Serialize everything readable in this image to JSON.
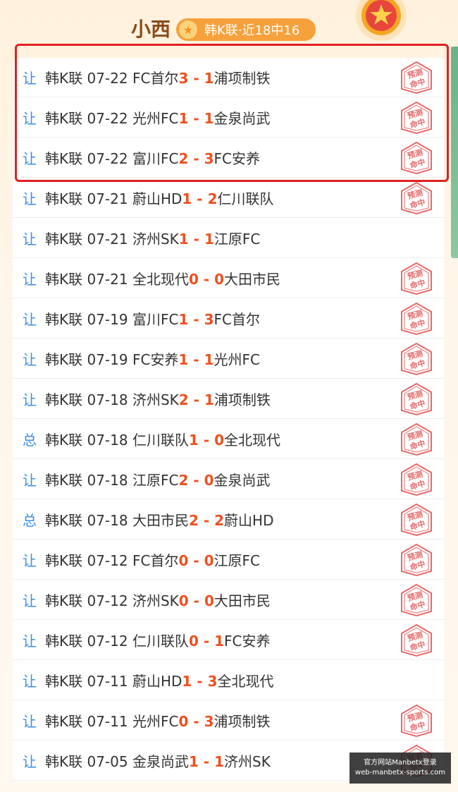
{
  "header": {
    "tipster_name": "小西",
    "badge_text": "韩K联·近18中16"
  },
  "matches": [
    {
      "type": "让",
      "league": "韩K联",
      "date": "07-22",
      "home": "FC首尔",
      "home_score": "3",
      "sep": " - ",
      "away_score": "1",
      "away": "浦项制铁",
      "hit": true
    },
    {
      "type": "让",
      "league": "韩K联",
      "date": "07-22",
      "home": "光州FC",
      "home_score": "1",
      "sep": " - ",
      "away_score": "1",
      "away": "金泉尚武",
      "hit": true
    },
    {
      "type": "让",
      "league": "韩K联",
      "date": "07-22",
      "home": "富川FC",
      "home_score": "2",
      "sep": " - ",
      "away_score": "3",
      "away": "FC安养",
      "hit": true
    },
    {
      "type": "让",
      "league": "韩K联",
      "date": "07-21",
      "home": "蔚山HD",
      "home_score": "1",
      "sep": " - ",
      "away_score": "2",
      "away": "仁川联队",
      "hit": true
    },
    {
      "type": "让",
      "league": "韩K联",
      "date": "07-21",
      "home": "济州SK",
      "home_score": "1",
      "sep": " - ",
      "away_score": "1",
      "away": "江原FC",
      "hit": false
    },
    {
      "type": "让",
      "league": "韩K联",
      "date": "07-21",
      "home": "全北现代",
      "home_score": "0",
      "sep": " - ",
      "away_score": "0",
      "away": "大田市民",
      "hit": true
    },
    {
      "type": "让",
      "league": "韩K联",
      "date": "07-19",
      "home": "富川FC",
      "home_score": "1",
      "sep": " - ",
      "away_score": "3",
      "away": "FC首尔",
      "hit": true
    },
    {
      "type": "让",
      "league": "韩K联",
      "date": "07-19",
      "home": "FC安养",
      "home_score": "1",
      "sep": " - ",
      "away_score": "1",
      "away": "光州FC",
      "hit": true
    },
    {
      "type": "让",
      "league": "韩K联",
      "date": "07-18",
      "home": "济州SK",
      "home_score": "2",
      "sep": " - ",
      "away_score": "1",
      "away": "浦项制铁",
      "hit": true
    },
    {
      "type": "总",
      "league": "韩K联",
      "date": "07-18",
      "home": "仁川联队",
      "home_score": "1",
      "sep": " - ",
      "away_score": "0",
      "away": "全北现代",
      "hit": true
    },
    {
      "type": "让",
      "league": "韩K联",
      "date": "07-18",
      "home": "江原FC",
      "home_score": "2",
      "sep": " - ",
      "away_score": "0",
      "away": "金泉尚武",
      "hit": true
    },
    {
      "type": "总",
      "league": "韩K联",
      "date": "07-18",
      "home": "大田市民",
      "home_score": "2",
      "sep": " - ",
      "away_score": "2",
      "away": "蔚山HD",
      "hit": true
    },
    {
      "type": "让",
      "league": "韩K联",
      "date": "07-12",
      "home": "FC首尔",
      "home_score": "0",
      "sep": " - ",
      "away_score": "0",
      "away": "江原FC",
      "hit": true
    },
    {
      "type": "让",
      "league": "韩K联",
      "date": "07-12",
      "home": "济州SK",
      "home_score": "0",
      "sep": " - ",
      "away_score": "0",
      "away": "大田市民",
      "hit": true
    },
    {
      "type": "让",
      "league": "韩K联",
      "date": "07-12",
      "home": "仁川联队",
      "home_score": "0",
      "sep": " - ",
      "away_score": "1",
      "away": "FC安养",
      "hit": true
    },
    {
      "type": "让",
      "league": "韩K联",
      "date": "07-11",
      "home": "蔚山HD",
      "home_score": "1",
      "sep": " - ",
      "away_score": "3",
      "away": "全北现代",
      "hit": false
    },
    {
      "type": "让",
      "league": "韩K联",
      "date": "07-11",
      "home": "光州FC",
      "home_score": "0",
      "sep": " - ",
      "away_score": "3",
      "away": "浦项制铁",
      "hit": true
    },
    {
      "type": "让",
      "league": "韩K联",
      "date": "07-05",
      "home": "金泉尚武",
      "home_score": "1",
      "sep": " - ",
      "away_score": "1",
      "away": "济州SK",
      "hit": true
    }
  ],
  "stamp_text": [
    "预测",
    "命中"
  ],
  "stamp_color": "#e46a6a",
  "score_color": "#f0501e",
  "type_color": "#3a8ee6",
  "watermark": {
    "line1": "官方网站Manbetx登录",
    "line2": "web-manbetx-sports.com"
  }
}
